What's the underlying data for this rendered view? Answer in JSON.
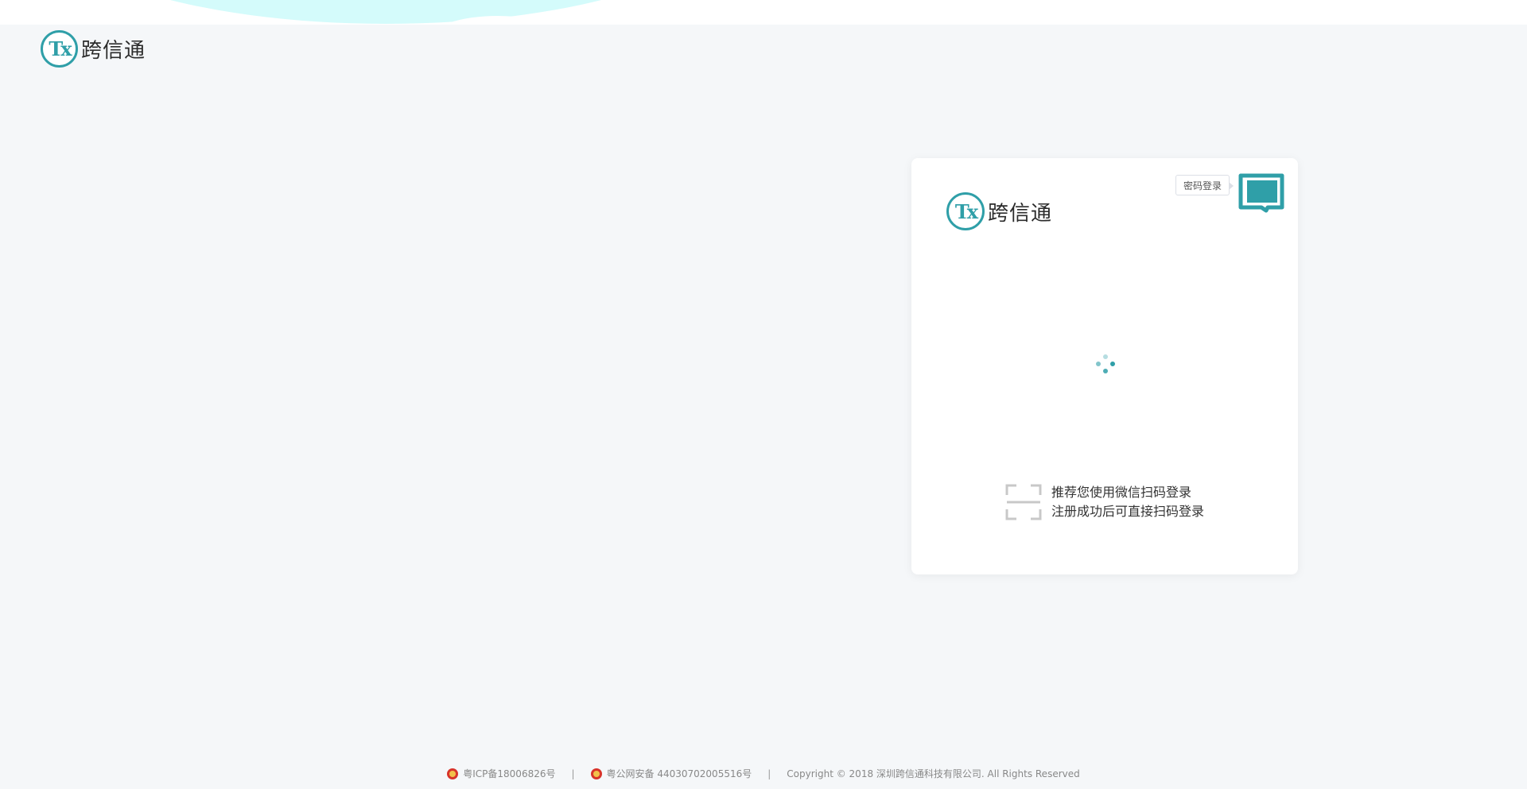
{
  "brand": {
    "logo_mark": "Tx",
    "name": "跨信通",
    "accent_color": "#2f9fa8"
  },
  "login_card": {
    "password_login_label": "密码登录",
    "switch_icon": "qr-code-switch-icon",
    "loading_icon": "loading-spinner-icon",
    "scan_icon": "scan-frame-icon",
    "hint_line1": "推荐您使用微信扫码登录",
    "hint_line2": "注册成功后可直接扫码登录"
  },
  "footer": {
    "icp": "粤ICP备18006826号",
    "police_record": "粤公网安备 44030702005516号",
    "copyright": "Copyright © 2018 深圳跨信通科技有限公司. All Rights Reserved",
    "separator": "|"
  }
}
